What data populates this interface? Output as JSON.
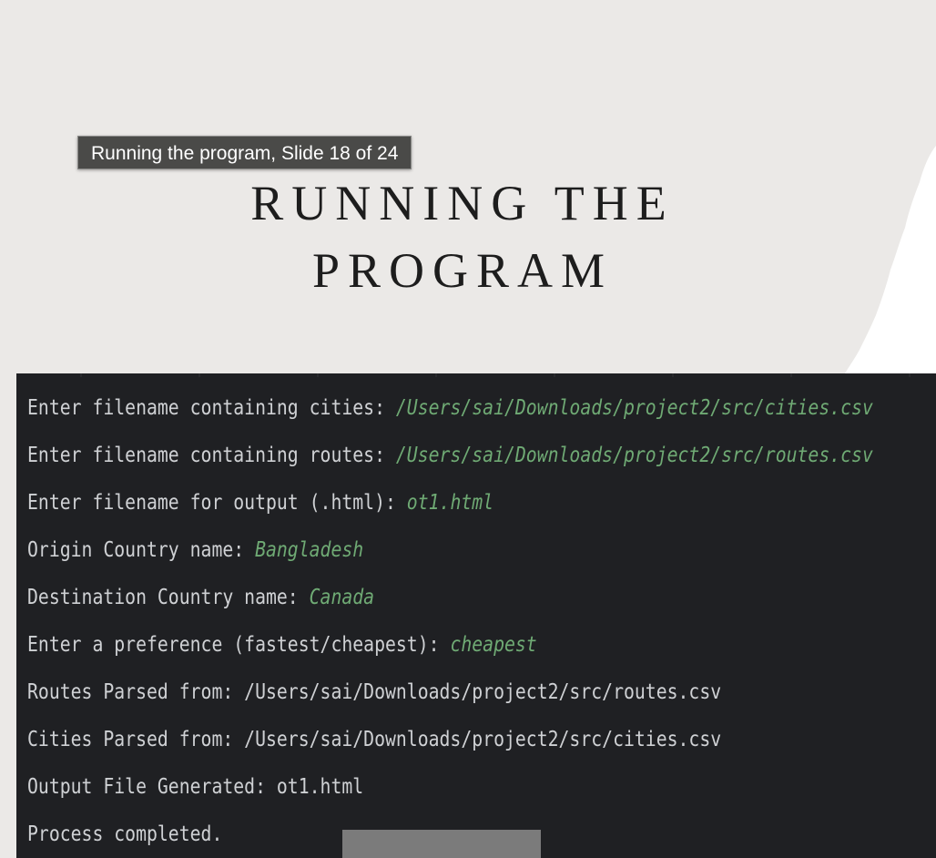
{
  "tooltip": {
    "text": "Running the program, Slide 18 of 24"
  },
  "slide": {
    "title_line1": "RUNNING THE",
    "title_line2": "PROGRAM"
  },
  "terminal": {
    "lines": [
      {
        "prompt": "Enter filename containing cities: ",
        "input": "/Users/sai/Downloads/project2/src/cities.csv"
      },
      {
        "prompt": "Enter filename containing routes: ",
        "input": "/Users/sai/Downloads/project2/src/routes.csv"
      },
      {
        "prompt": "Enter filename for output (.html): ",
        "input": "ot1.html"
      },
      {
        "prompt": "Origin Country name: ",
        "input": "Bangladesh"
      },
      {
        "prompt": "Destination Country name: ",
        "input": "Canada"
      },
      {
        "prompt": "Enter a preference (fastest/cheapest): ",
        "input": "cheapest"
      },
      {
        "prompt": "Routes Parsed from: /Users/sai/Downloads/project2/src/routes.csv",
        "input": ""
      },
      {
        "prompt": "Cities Parsed from: /Users/sai/Downloads/project2/src/cities.csv",
        "input": ""
      },
      {
        "prompt": "Output File Generated: ot1.html",
        "input": ""
      },
      {
        "prompt": "Process completed.",
        "input": ""
      }
    ]
  },
  "colors": {
    "slide_background": "#ebe9e7",
    "torn_paper": "#ffffff",
    "terminal_background": "#1f2023",
    "terminal_text": "#cfd1d4",
    "terminal_user_input": "#6faa74",
    "tooltip_background": "#4a4a48"
  }
}
